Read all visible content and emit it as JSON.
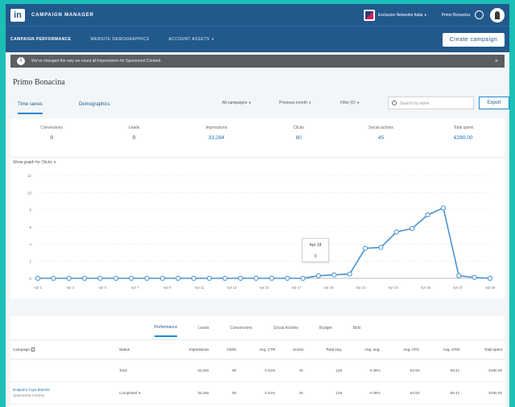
{
  "topbar": {
    "logo": "in",
    "app_title": "CAMPAIGN MANAGER",
    "account_name": "Exclusive Networks Italia",
    "user_name": "Primo Bonacina"
  },
  "nav": {
    "items": [
      "CAMPAIGN PERFORMANCE",
      "WEBSITE DEMOGRAPHICS",
      "ACCOUNT ASSETS"
    ],
    "create_button": "Create campaign"
  },
  "alert": {
    "text": "We've changed the way we count all impressions for Sponsored Content."
  },
  "page": {
    "title": "Primo Bonacina",
    "view_tabs": [
      "Time series",
      "Demographics"
    ],
    "filters": [
      "All campaigns",
      "Previous month",
      "Filter (0)"
    ],
    "search_placeholder": "Search by name",
    "export_label": "Export"
  },
  "metrics": [
    {
      "label": "Conversions",
      "value": "0"
    },
    {
      "label": "Leads",
      "value": "0"
    },
    {
      "label": "Impressions",
      "value": "33,284"
    },
    {
      "label": "Clicks",
      "value": "80"
    },
    {
      "label": "Social actions",
      "value": "45"
    },
    {
      "label": "Total spent",
      "value": "€280.00"
    }
  ],
  "chart_header": {
    "prefix": "Show graph for",
    "metric": "Clicks"
  },
  "tooltip": {
    "date": "Apr 18",
    "value": "0"
  },
  "chart_data": {
    "type": "line",
    "ylim": [
      0,
      12
    ],
    "yticks": [
      "0",
      "2",
      "4",
      "6",
      "8",
      "10",
      "12"
    ],
    "x_ticks": [
      "Apr 1",
      "Apr 3",
      "Apr 5",
      "Apr 7",
      "Apr 9",
      "Apr 11",
      "Apr 13",
      "Apr 15",
      "Apr 17",
      "Apr 19",
      "Apr 21",
      "Apr 23",
      "Apr 25",
      "Apr 27",
      "Apr 29"
    ],
    "series": [
      {
        "values": [
          0,
          0,
          0,
          0,
          0,
          0,
          0,
          0,
          0,
          0,
          0,
          0,
          0,
          0,
          0,
          0,
          0,
          0,
          0.3,
          0.4,
          0.5,
          3.5,
          3.6,
          5.4,
          5.8,
          7.4,
          8.2,
          0.3,
          0.1,
          0
        ]
      }
    ],
    "line_color": "#4a93cf",
    "grid": true
  },
  "table": {
    "tabs": [
      "Performance",
      "Leads",
      "Conversions",
      "Social Actions",
      "Budget",
      "Bids"
    ],
    "columns": [
      "Campaign",
      "Status",
      "Impressions",
      "Clicks",
      "Avg. CTR",
      "Social",
      "Total eng.",
      "Avg. eng.",
      "Avg. CPC",
      "Avg. CPM",
      "Total spent"
    ],
    "total_row": [
      "",
      "Total",
      "33,284",
      "80",
      "0.24%",
      "45",
      "125",
      "0.38%",
      "€3.50",
      "€8.41",
      "€280.00"
    ],
    "rows": [
      {
        "name": "Endpoint Tuya Marche",
        "type": "Sponsored Content",
        "status": "Completed",
        "values": [
          "33,284",
          "80",
          "0.24%",
          "45",
          "125",
          "0.38%",
          "€3.50",
          "€8.41",
          "€280.00"
        ]
      }
    ]
  }
}
